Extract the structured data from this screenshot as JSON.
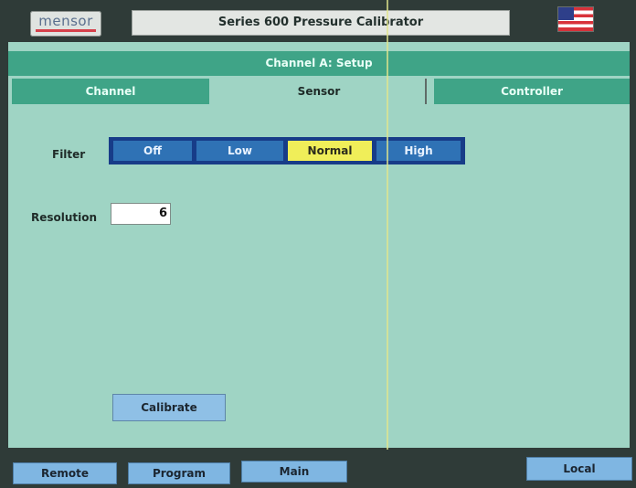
{
  "header": {
    "logo_text": "mensor",
    "title": "Series 600 Pressure Calibrator",
    "flag_icon": "us-flag-icon"
  },
  "panel": {
    "title": "Channel A: Setup",
    "tabs": [
      {
        "label": "Channel",
        "active": false
      },
      {
        "label": "Sensor",
        "active": true
      },
      {
        "label": "Controller",
        "active": false
      }
    ]
  },
  "filter": {
    "label": "Filter",
    "options": [
      "Off",
      "Low",
      "Normal",
      "High"
    ],
    "selected": "Normal"
  },
  "resolution": {
    "label": "Resolution",
    "value": "6"
  },
  "calibrate_label": "Calibrate",
  "bottom_bar": {
    "remote": "Remote",
    "program": "Program",
    "main": "Main",
    "local": "Local"
  },
  "colors": {
    "panel_bg": "#9fd4c4",
    "header_bg": "#3fa487",
    "selected_option": "#f0ee59",
    "button_blue": "#7fb6e2",
    "filter_option": "#2f72b5"
  }
}
